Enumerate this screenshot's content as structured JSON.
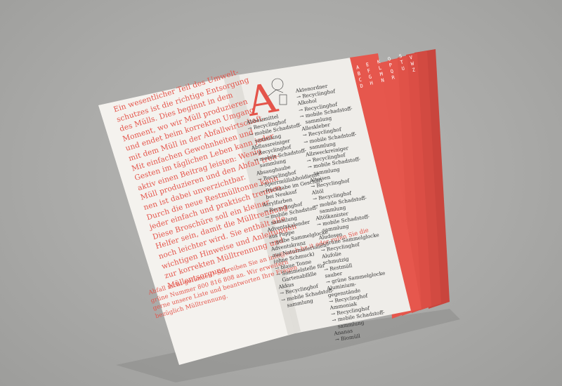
{
  "left_page": {
    "main_text": "Ein wesentlicher Teil des Umwelt-\nschutzes ist die richtige Entsorgung\ndes Mülls. Dies beginnt in dem\nMoment, wo wir Müll produzieren\nund endet beim korrekten Umgang\nmit dem Müll in der Abfallwirtschaft.\nMit einfachen Gewohnheiten und\nGesten im täglichen Leben kann jeder\naktiv einen Beitrag leisten: Wenig\nMüll produzieren und den Abfall tren-\nnen ist dabei unverzichtbar.\nDurch die neue Restmülltonne kann\njeder einfach und praktisch trennen.\nDiese Broschüre soll ein kleiner\nHelfer sein, damit die Mülltrennung\nnoch leichter wird. Sie enthält alle\nwichtigen Hinweise und Anleitungen\nzur korrekten Mülltrennung und\nMüllentsorgung.",
    "footer_text": "Abfall nicht gefunden? Schreiben Sie an info@seab.bz.it oder rufen Sie die\ngrüne Nummer 800 816 808 an. Wir erweitern\ngerne unsere Liste und beantworten Ihre Fragen\nbezüglich Mülltrennung."
  },
  "right_page": {
    "big_letter": "A",
    "col1": "Abbeizmittel\n→ Recyclinghof\n→ mobile Schadstoff-\n   sammlung\nAbflussreiniger\n→ Recyclinghof\n→ mobile Schadstoff-\n   sammlung\nAbsaughaube\n→ Recyclinghof\n→ Sperrmüllabholdienst\n→ Rückgabe im Geschäft\n   bei Neukauf\nAcrylfarben\n→ Recyclinghof\n→ mobile Schadstoff-\n   sammlung\nAdventskalender\naus Pappe\n→ gelbe Sammelglocke\nAdventskranz\naus Naturmaterialien\n(ohne Schmuck)\n→ blaue Tonne\n→ Sammelstelle für\n   Gartenabfälle\nAkkus\n→ Recyclinghof\n→ mobile Schadstoff-\n   sammlung",
    "col2": "Aktenordner\n→ Recyclinghof\nAlkohol\n→ Recyclinghof\n→ mobile Schadstoff-\n   sammlung\nAlleskleber\n→ Recyclinghof\n→ mobile Schadstoff-\n   sammlung\nAllzweckreiniger\n→ Recyclinghof\n→ mobile Schadstoff-\n   sammlung\nAlteisen\n→ Recyclinghof\nAltöl\n→ Recyclinghof\n→ mobile Schadstoff-\n   sammlung\nAltölkanister\n→ mobile Schadstoff-\n   sammlung\nAludosen\n→ grüne Sammelglocke\n→ Recyclinghof\nAlufolie\nschmutzig\n→ Restmüll\nsauber\n→ grüne Sammelglocke\nAluminium-\ngegenstände\n→ Recyclinghof\nAmmoniak\n→ Recyclinghof\n→ mobile Schadstoff-\n   sammlung\nAnanas\n→ Biomüll",
    "tabs_col1": "A\nB\nC\nD",
    "tabs_col2": "E\nF\nG\nH",
    "tabs_col3": "K\nL\nM\nN",
    "tabs_col4": "O\nP\nQ\nR",
    "tabs_col5": "S\nT\nU",
    "tabs_col6": "V\nW\nZ"
  },
  "colors": {
    "accent": "#e4544a",
    "paper": "#f2f0ec",
    "background": "#aaaaa8"
  }
}
